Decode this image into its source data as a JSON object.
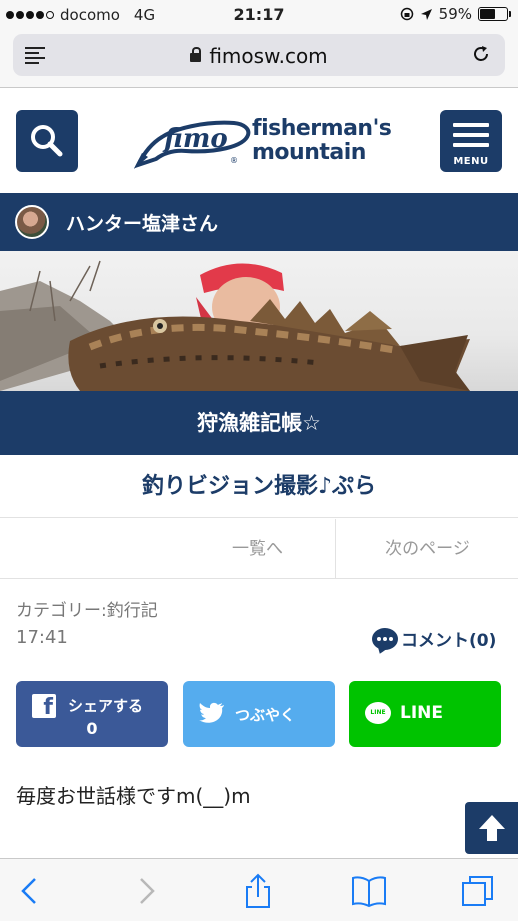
{
  "status_bar": {
    "carrier": "docomo",
    "network": "4G",
    "time": "21:17",
    "battery": "59%",
    "battery_fraction": 0.59,
    "signal_bars_filled": 4
  },
  "address_bar": {
    "url": "fimosw.com",
    "secure": true,
    "icons": [
      "reader-icon",
      "lock-icon",
      "reload-icon"
    ]
  },
  "site_header": {
    "logo_mark": "fimo",
    "logo_line1": "fisherman's",
    "logo_line2": "mountain",
    "menu_label": "MENU",
    "icons": [
      "search-icon",
      "menu-icon"
    ]
  },
  "blogger": {
    "name": "ハンター塩津さん"
  },
  "blog": {
    "title": "狩漁雑記帳☆"
  },
  "post": {
    "title": "釣りビジョン撮影♪ぷら",
    "category": "カテゴリー:釣行記",
    "time": "17:41",
    "comment_label": "コメント(0)",
    "body": "毎度お世話様ですm(__)m"
  },
  "pager": {
    "list_label": "一覧へ",
    "next_label": "次のページ"
  },
  "share": {
    "facebook_label": "シェアする",
    "facebook_count": "0",
    "twitter_label": "つぶやく",
    "line_label": "LINE"
  },
  "colors": {
    "brand_navy": "#1c3c68",
    "facebook": "#3b5998",
    "twitter": "#55acee",
    "line": "#00c300"
  },
  "toolbar": {
    "icons": [
      "back-icon",
      "forward-icon",
      "share-icon",
      "bookmarks-icon",
      "tabs-icon"
    ]
  }
}
